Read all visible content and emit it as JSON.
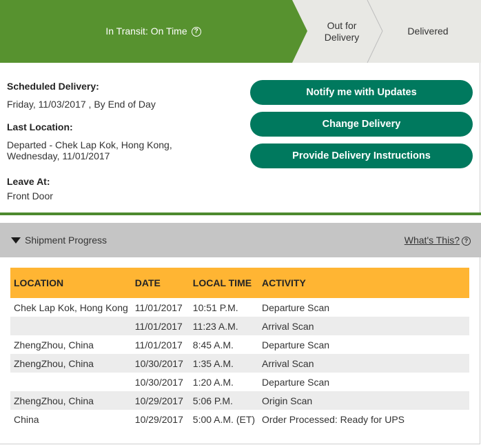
{
  "progress_steps": [
    {
      "label": "In Transit: On Time",
      "state": "current"
    },
    {
      "label": "Out for\nDelivery",
      "state": "upcoming"
    },
    {
      "label": "Delivered",
      "state": "upcoming"
    }
  ],
  "help_glyph": "?",
  "details": {
    "scheduled_label": "Scheduled Delivery:",
    "scheduled_value": "Friday, 11/03/2017 , By End of Day",
    "last_location_label": "Last Location:",
    "last_location_line1": "Departed - Chek Lap Kok, Hong Kong,",
    "last_location_line2": "Wednesday, 11/01/2017",
    "leave_at_label": "Leave At:",
    "leave_at_value": "Front Door"
  },
  "actions": {
    "notify": "Notify me with Updates",
    "change": "Change Delivery",
    "instructions": "Provide Delivery Instructions"
  },
  "shipment_progress": {
    "title": "Shipment Progress",
    "whats_this": "What's This?",
    "columns": [
      "LOCATION",
      "DATE",
      "LOCAL TIME",
      "ACTIVITY"
    ],
    "rows": [
      {
        "location": "Chek Lap Kok,  Hong Kong",
        "date": "11/01/2017",
        "time": "10:51 P.M.",
        "activity": "Departure Scan"
      },
      {
        "location": "",
        "date": "11/01/2017",
        "time": "11:23 A.M.",
        "activity": "Arrival Scan"
      },
      {
        "location": "ZhengZhou,  China",
        "date": "11/01/2017",
        "time": "8:45 A.M.",
        "activity": "Departure Scan"
      },
      {
        "location": "ZhengZhou,  China",
        "date": "10/30/2017",
        "time": "1:35 A.M.",
        "activity": "Arrival Scan"
      },
      {
        "location": "",
        "date": "10/30/2017",
        "time": "1:20 A.M.",
        "activity": "Departure Scan"
      },
      {
        "location": "ZhengZhou,  China",
        "date": "10/29/2017",
        "time": "5:06 P.M.",
        "activity": "Origin Scan"
      },
      {
        "location": "China",
        "date": "10/29/2017",
        "time": "5:00 A.M. (ET)",
        "activity": "Order Processed: Ready for UPS"
      }
    ]
  },
  "colors": {
    "step_active": "#57922f",
    "step_inactive": "#e8e8e4",
    "button": "#00795e",
    "table_header": "#ffb533",
    "section_header": "#c5c5c5"
  }
}
